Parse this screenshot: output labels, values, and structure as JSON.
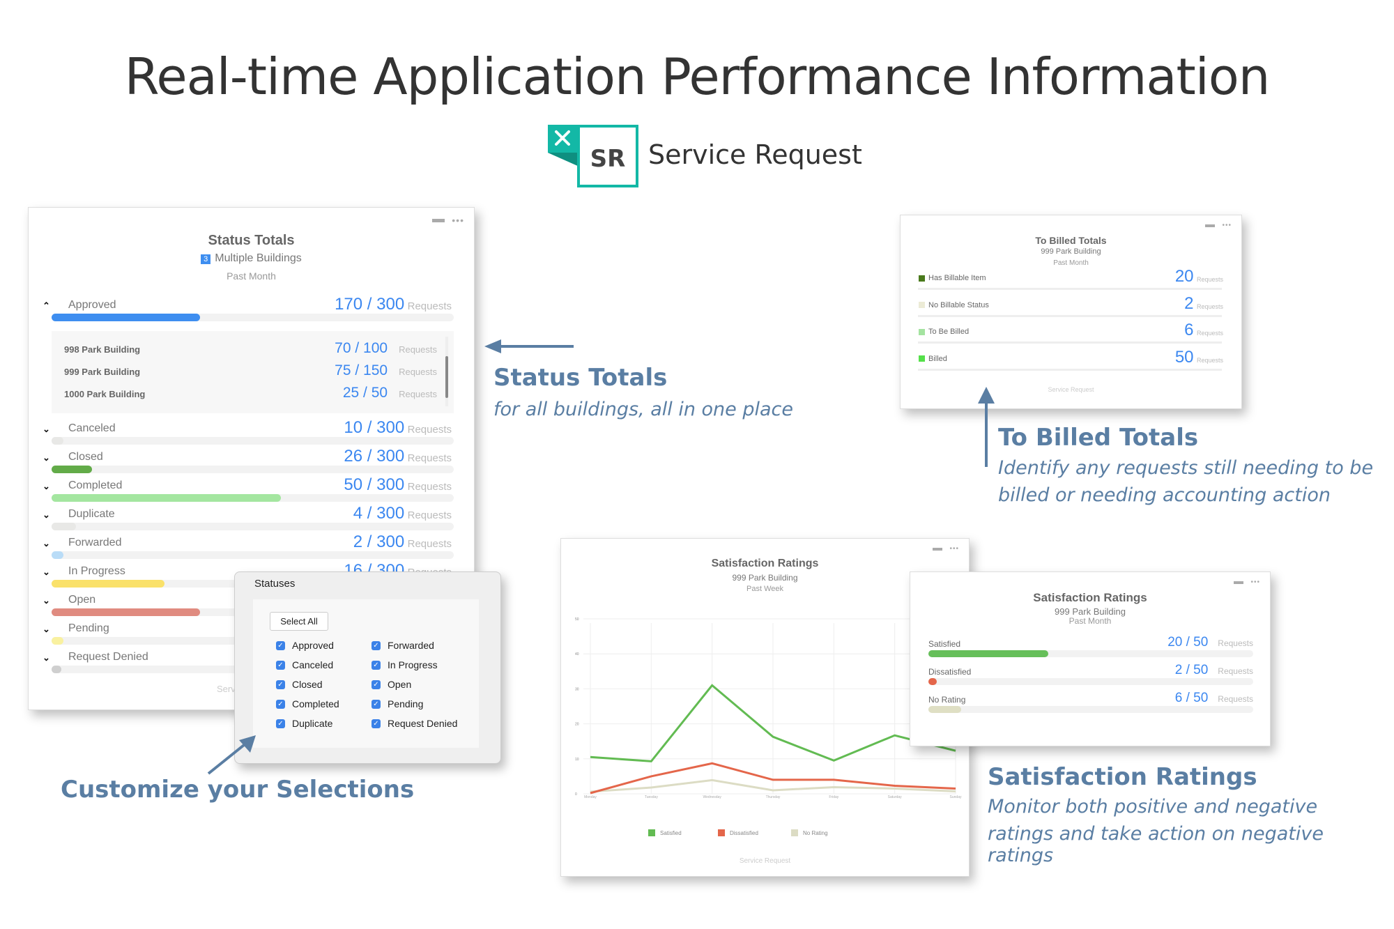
{
  "header": {
    "title": "Real-time Application Performance Information",
    "brand": "Service Request",
    "logo_text": "SR",
    "logo_icon": "wrench-screwdriver-icon"
  },
  "colors": {
    "accent_teal": "#13b8a6",
    "number_blue": "#3b87f0",
    "annotation": "#5a7ea3"
  },
  "status_totals": {
    "title": "Status Totals",
    "badge": "3",
    "subtitle": "Multiple Buildings",
    "period": "Past Month",
    "footer": "Serv",
    "unit": "Requests",
    "approved": {
      "label": "Approved",
      "value": "170 / 300",
      "fill": 0.37,
      "color": "#3e8ef0",
      "expanded": true,
      "buildings": [
        {
          "name": "998 Park Building",
          "value": "70 / 100"
        },
        {
          "name": "999 Park Building",
          "value": "75 / 150"
        },
        {
          "name": "1000 Park Building",
          "value": "25 / 50"
        }
      ]
    },
    "rows": [
      {
        "label": "Canceled",
        "value": "10 / 300",
        "fill": 0.03,
        "color": "#e8e8e6"
      },
      {
        "label": "Closed",
        "value": "26 / 300",
        "fill": 0.1,
        "color": "#62ab48"
      },
      {
        "label": "Completed",
        "value": "50 / 300",
        "fill": 0.57,
        "color": "#a4e6a0"
      },
      {
        "label": "Duplicate",
        "value": "4 / 300",
        "fill": 0.06,
        "color": "#e8e8e6"
      },
      {
        "label": "Forwarded",
        "value": "2 / 300",
        "fill": 0.03,
        "color": "#b9dcf7"
      },
      {
        "label": "In Progress",
        "value": "16 / 300",
        "fill": 0.28,
        "color": "#fae16a"
      },
      {
        "label": "Open",
        "value": "",
        "fill": 0.37,
        "color": "#e08b80"
      },
      {
        "label": "Pending",
        "value": "",
        "fill": 0.03,
        "color": "#f9f1a0"
      },
      {
        "label": "Request Denied",
        "value": "",
        "fill": 0.01,
        "color": "#cfcfcf"
      }
    ]
  },
  "statuses_popup": {
    "title": "Statuses",
    "select_all": "Select All",
    "options": [
      {
        "label": "Approved",
        "checked": true
      },
      {
        "label": "Canceled",
        "checked": true
      },
      {
        "label": "Closed",
        "checked": true
      },
      {
        "label": "Completed",
        "checked": true
      },
      {
        "label": "Duplicate",
        "checked": true
      },
      {
        "label": "Forwarded",
        "checked": true
      },
      {
        "label": "In Progress",
        "checked": true
      },
      {
        "label": "Open",
        "checked": true
      },
      {
        "label": "Pending",
        "checked": true
      },
      {
        "label": "Request Denied",
        "checked": true
      }
    ]
  },
  "billed": {
    "title": "To Billed Totals",
    "subtitle": "999 Park Building",
    "period": "Past Month",
    "footer": "Service Request",
    "unit": "Requests",
    "rows": [
      {
        "label": "Has Billable Item",
        "value": "20",
        "color": "#4a7a1c"
      },
      {
        "label": "No Billable Status",
        "value": "2",
        "color": "#ecebd6"
      },
      {
        "label": "To Be Billed",
        "value": "6",
        "color": "#a4e3a0"
      },
      {
        "label": "Billed",
        "value": "50",
        "color": "#55e04a"
      }
    ]
  },
  "satisfaction_small": {
    "title": "Satisfaction Ratings",
    "subtitle": "999 Park Building",
    "period": "Past Month",
    "unit": "Requests",
    "rows": [
      {
        "label": "Satisfied",
        "value": "20 / 50",
        "fill": 0.37,
        "color": "#66bf5a"
      },
      {
        "label": "Dissatisfied",
        "value": "2 / 50",
        "fill": 0.02,
        "color": "#e4664a"
      },
      {
        "label": "No Rating",
        "value": "6 / 50",
        "fill": 0.1,
        "color": "#dfdfc4"
      }
    ]
  },
  "satisfaction_chart": {
    "title": "Satisfaction Ratings",
    "subtitle": "999 Park Building",
    "period": "Past Week",
    "footer": "Service Request"
  },
  "chart_data": {
    "type": "line",
    "title": "Satisfaction Ratings",
    "x": [
      "Monday",
      "Tuesday",
      "Wednesday",
      "Thursday",
      "Friday",
      "Saturday",
      "Sunday"
    ],
    "ylim": [
      0,
      50
    ],
    "yticks": [
      0,
      10,
      20,
      30,
      40,
      50
    ],
    "grid": true,
    "legend": "bottom",
    "series": [
      {
        "name": "Satisfied",
        "color": "#62bb52",
        "values": [
          10.5,
          9.3,
          31,
          16.3,
          9.5,
          16.7,
          12.3
        ]
      },
      {
        "name": "Dissatisfied",
        "color": "#e4664a",
        "values": [
          0.2,
          5,
          8.7,
          4,
          4,
          2.3,
          1.5
        ]
      },
      {
        "name": "No Rating",
        "color": "#dcdcc4",
        "values": [
          0.6,
          1.8,
          3.9,
          1,
          1.9,
          1.5,
          0.7
        ]
      }
    ]
  },
  "annotations": {
    "status": {
      "title": "Status Totals",
      "text": "for all buildings, all in one place"
    },
    "billed": {
      "title": "To Billed Totals",
      "line1": "Identify any requests still needing to be",
      "line2": "billed or needing accounting action"
    },
    "customize": {
      "title": "Customize your Selections"
    },
    "satisfaction": {
      "title": "Satisfaction Ratings",
      "line1": "Monitor both positive and negative",
      "line2": "ratings and take action on negative ratings"
    }
  }
}
